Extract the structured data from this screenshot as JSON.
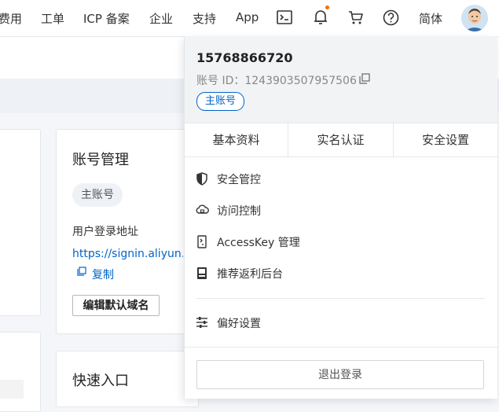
{
  "topnav": {
    "items": [
      "费用",
      "工单",
      "ICP 备案",
      "企业",
      "支持",
      "App"
    ],
    "lang": "简体",
    "icons": [
      "terminal-icon",
      "bell-icon",
      "cart-icon",
      "help-icon"
    ]
  },
  "account_card": {
    "title": "账号管理",
    "tag": "主账号",
    "login_label": "用户登录地址",
    "login_url": "https://signin.aliyun.c",
    "copy_label": "复制",
    "edit_button": "编辑默认域名"
  },
  "quick_card": {
    "title": "快速入口"
  },
  "dropdown": {
    "phone": "15768866720",
    "account_id_label": "账号 ID：",
    "account_id": "1243903507957506",
    "badge": "主账号",
    "tabs": [
      "基本资料",
      "实名认证",
      "安全设置"
    ],
    "menu": [
      {
        "label": "安全管控",
        "icon": "shield-icon"
      },
      {
        "label": "访问控制",
        "icon": "cloud-icon"
      },
      {
        "label": "AccessKey 管理",
        "icon": "key-icon"
      },
      {
        "label": "推荐返利后台",
        "icon": "gift-icon"
      }
    ],
    "preferences": {
      "label": "偏好设置",
      "icon": "sliders-icon"
    },
    "logout": "退出登录"
  },
  "colors": {
    "accent": "#0064c8",
    "notification_dot": "#ff6a00",
    "header_bg": "#f2f3f5"
  }
}
